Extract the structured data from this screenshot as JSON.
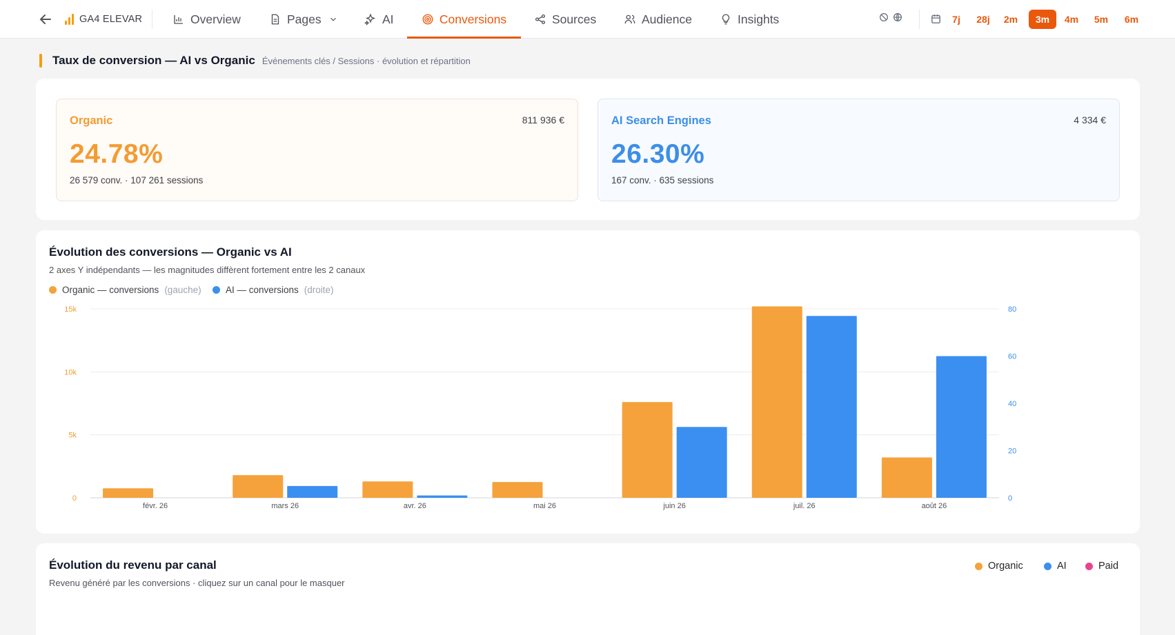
{
  "nav": {
    "brand": "GA4 ELEVAR",
    "tabs": [
      {
        "label": "Overview"
      },
      {
        "label": "Pages"
      },
      {
        "label": "AI"
      },
      {
        "label": "Conversions"
      },
      {
        "label": "Sources"
      },
      {
        "label": "Audience"
      },
      {
        "label": "Insights"
      }
    ],
    "ranges": [
      "7j",
      "28j",
      "2m",
      "3m",
      "4m",
      "5m",
      "6m"
    ],
    "active_range": "3m",
    "accent": "#ea580c"
  },
  "section": {
    "title": "Taux de conversion — AI vs Organic",
    "subtitle": "Événements clés / Sessions · évolution et répartition"
  },
  "kpis": {
    "organic": {
      "name": "Organic",
      "revenue": "811 936 €",
      "rate": "24.78%",
      "meta": "26 579 conv. · 107 261 sessions",
      "color": "#f39c32"
    },
    "ai": {
      "name": "AI Search Engines",
      "revenue": "4 334 €",
      "rate": "26.30%",
      "meta": "167 conv. · 635 sessions",
      "color": "#3d8ee8"
    }
  },
  "conv_chart": {
    "title": "Évolution des conversions — Organic vs AI",
    "subtitle": "2 axes Y indépendants — les magnitudes diffèrent fortement entre les 2 canaux",
    "legend": [
      {
        "label": "Organic — conversions",
        "note": "(gauche)",
        "color": "#f5a23c"
      },
      {
        "label": "AI — conversions",
        "note": "(droite)",
        "color": "#3b8ff0"
      }
    ]
  },
  "revenue_chart": {
    "title": "Évolution du revenu par canal",
    "subtitle": "Revenu généré par les conversions · cliquez sur un canal pour le masquer",
    "legend": [
      {
        "label": "Organic",
        "color": "#f5a23c"
      },
      {
        "label": "AI",
        "color": "#3b8ff0"
      },
      {
        "label": "Paid",
        "color": "#e84393"
      }
    ]
  },
  "chart_data": {
    "type": "bar",
    "categories": [
      "févr. 26",
      "mars 26",
      "avr. 26",
      "mai 26",
      "juin 26",
      "juil. 26",
      "août 26"
    ],
    "series": [
      {
        "name": "Organic — conversions",
        "axis": "left",
        "color": "#f5a23c",
        "values": [
          750,
          1800,
          1300,
          1250,
          7600,
          15200,
          3200
        ]
      },
      {
        "name": "AI — conversions",
        "axis": "right",
        "color": "#3b8ff0",
        "values": [
          0,
          5,
          1,
          0,
          30,
          77,
          60
        ]
      }
    ],
    "y_left": {
      "ticks": [
        "0",
        "5k",
        "10k",
        "15k"
      ],
      "tick_values": [
        0,
        5000,
        10000,
        15000
      ],
      "max": 15000,
      "color": "#f39c32"
    },
    "y_right": {
      "ticks": [
        "0",
        "20",
        "40",
        "60",
        "80"
      ],
      "tick_values": [
        0,
        20,
        40,
        60,
        80
      ],
      "max": 80,
      "color": "#3d8ee8"
    },
    "grid": true
  }
}
